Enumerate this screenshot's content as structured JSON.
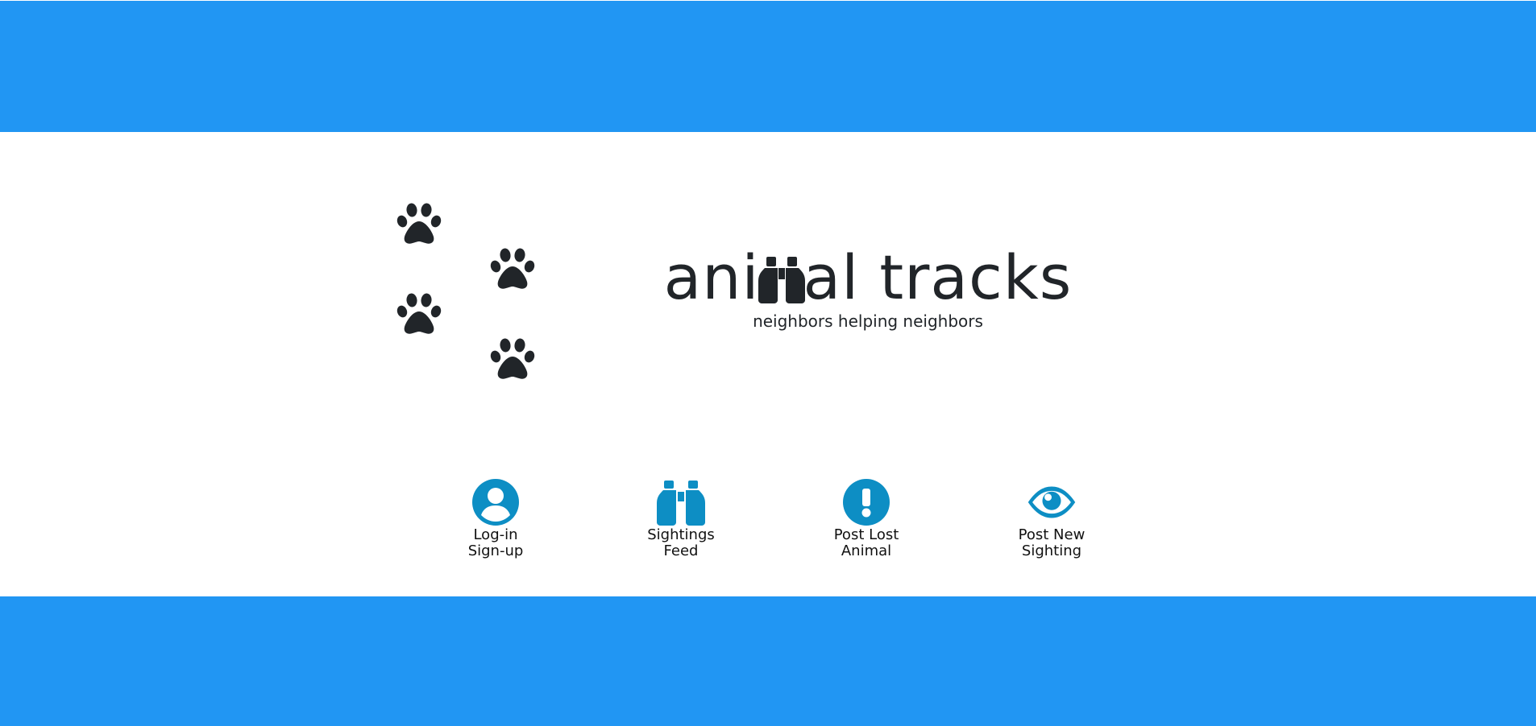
{
  "colors": {
    "band": "#2196f3",
    "icon_accent": "#0d8ec4",
    "text_dark": "#212529"
  },
  "brand": {
    "title_before": "ani",
    "title_icon": "binoculars-icon",
    "title_after": "al tracks",
    "tagline": "neighbors helping neighbors"
  },
  "decor": {
    "paw_icons": [
      "paw-icon",
      "paw-icon",
      "paw-icon",
      "paw-icon"
    ]
  },
  "nav": {
    "login": {
      "icon": "user-circle-icon",
      "line1": "Log-in",
      "line2": "Sign-up"
    },
    "feed": {
      "icon": "binoculars-icon",
      "line1": "Sightings",
      "line2": "Feed"
    },
    "lost": {
      "icon": "exclamation-circle-icon",
      "line1": "Post Lost",
      "line2": "Animal"
    },
    "new": {
      "icon": "eye-icon",
      "line1": "Post New",
      "line2": "Sighting"
    }
  }
}
